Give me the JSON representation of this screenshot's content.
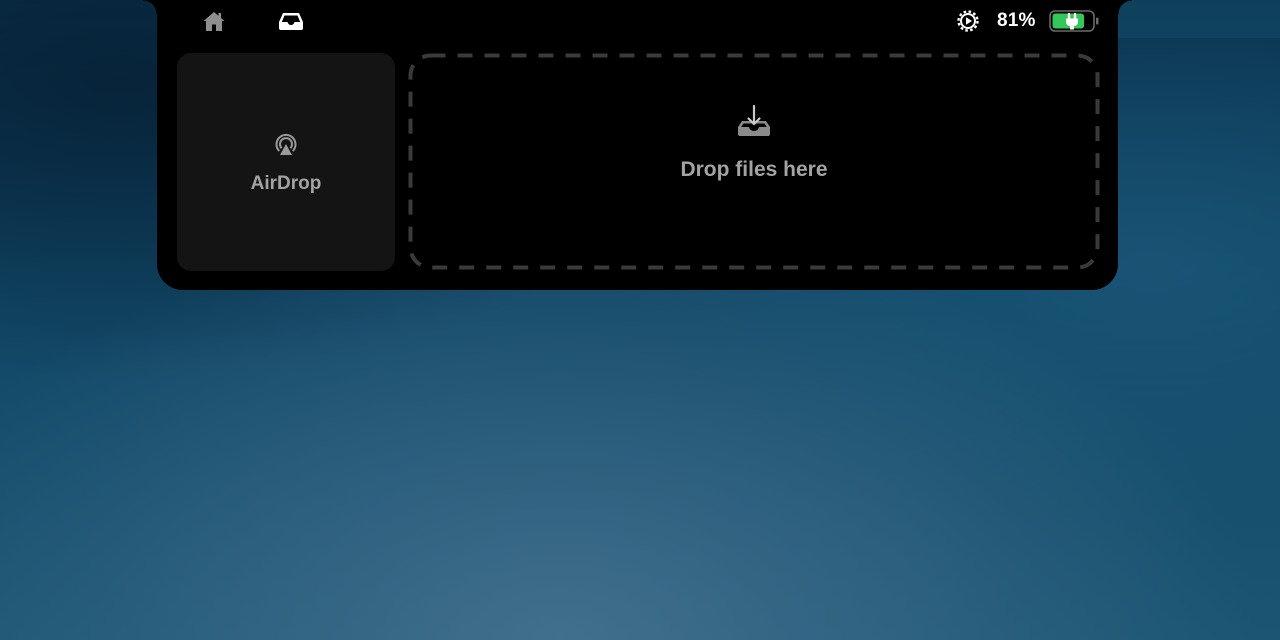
{
  "status": {
    "battery_percent": "81%",
    "battery_level": 0.81,
    "battery_charging": true,
    "battery_color": "#34c759"
  },
  "nav": {
    "home_icon": "house-icon",
    "tray_icon": "tray-icon"
  },
  "tiles": {
    "airdrop_label": "AirDrop",
    "airdrop_icon": "airdrop-icon"
  },
  "dropzone": {
    "label": "Drop files here",
    "icon": "tray-download-icon"
  }
}
